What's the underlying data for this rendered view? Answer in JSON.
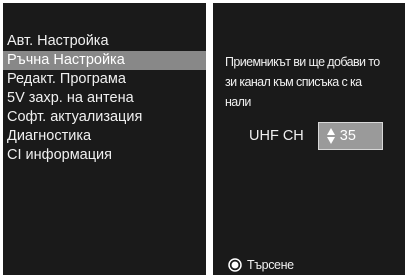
{
  "menu": {
    "items": [
      {
        "label": "Авт. Настройка"
      },
      {
        "label": "Ръчна Настройка",
        "selected": true
      },
      {
        "label": "Редакт. Програма"
      },
      {
        "label": "5V захр. на антена"
      },
      {
        "label": "Софт. актуализация"
      },
      {
        "label": "Диагностика"
      },
      {
        "label": "CI информация"
      }
    ]
  },
  "info": {
    "line1": "Приемникът ви ще добави то",
    "line2": "зи канал към списъка с ка",
    "line3": "нали"
  },
  "channel": {
    "label": "UHF CH",
    "value": "35",
    "icon": "up-down-arrows-icon"
  },
  "footer": {
    "action_label": "Търсене",
    "icon": "radio-button-icon"
  },
  "colors": {
    "background": "#1a1a1a",
    "selected": "#888888",
    "text": "#f0f0f0",
    "field": "#9a9a9a"
  }
}
